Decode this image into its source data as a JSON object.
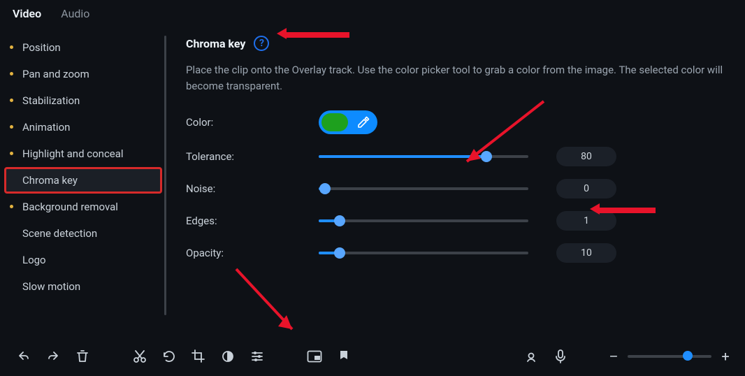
{
  "tabs": {
    "video": "Video",
    "audio": "Audio",
    "active": "video"
  },
  "sidebar": {
    "items": [
      {
        "label": "Position"
      },
      {
        "label": "Pan and zoom"
      },
      {
        "label": "Stabilization"
      },
      {
        "label": "Animation"
      },
      {
        "label": "Highlight and conceal"
      },
      {
        "label": "Chroma key",
        "selected": true
      },
      {
        "label": "Background removal",
        "dot": true
      },
      {
        "label": "Scene detection"
      },
      {
        "label": "Logo"
      },
      {
        "label": "Slow motion"
      }
    ]
  },
  "panel": {
    "title": "Chroma key",
    "helpIcon": "?",
    "description": "Place the clip onto the Overlay track. Use the color picker tool to grab a color from the image. The selected color will become transparent.",
    "color": {
      "label": "Color:",
      "swatch": "#1ea01e",
      "icon": "eyedropper-icon"
    },
    "sliders": {
      "tolerance": {
        "label": "Tolerance:",
        "value": 80,
        "max": 100
      },
      "noise": {
        "label": "Noise:",
        "value": 0,
        "max": 100
      },
      "edges": {
        "label": "Edges:",
        "value": 1,
        "max": 10
      },
      "opacity": {
        "label": "Opacity:",
        "value": 10,
        "max": 100
      }
    }
  },
  "toolbar": {
    "icons": [
      "undo-icon",
      "redo-icon",
      "delete-icon",
      "cut-icon",
      "rotate-icon",
      "crop-icon",
      "color-adjust-icon",
      "sliders-icon",
      "pip-icon",
      "marker-icon",
      "record-icon",
      "mic-icon"
    ],
    "zoom": {
      "position": 72
    },
    "zoomMinus": "–",
    "zoomPlus": "+"
  }
}
